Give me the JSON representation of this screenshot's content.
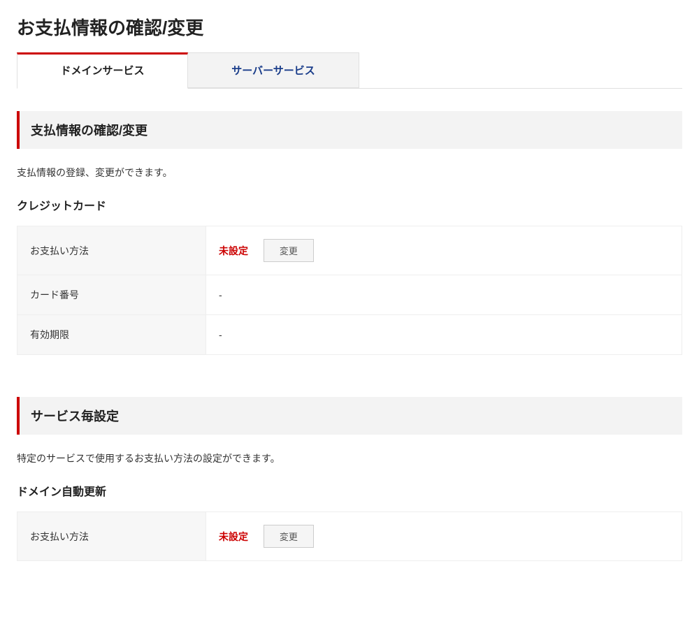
{
  "pageTitle": "お支払情報の確認/変更",
  "tabs": {
    "domain": "ドメインサービス",
    "server": "サーバーサービス"
  },
  "section1": {
    "header": "支払情報の確認/変更",
    "description": "支払情報の登録、変更ができます。",
    "creditCard": {
      "title": "クレジットカード",
      "rows": {
        "paymentMethodLabel": "お支払い方法",
        "paymentMethodStatus": "未設定",
        "paymentMethodButton": "変更",
        "cardNumberLabel": "カード番号",
        "cardNumberValue": "-",
        "expiryLabel": "有効期限",
        "expiryValue": "-"
      }
    }
  },
  "section2": {
    "header": "サービス毎設定",
    "description": "特定のサービスで使用するお支払い方法の設定ができます。",
    "domainAutoRenew": {
      "title": "ドメイン自動更新",
      "rows": {
        "paymentMethodLabel": "お支払い方法",
        "paymentMethodStatus": "未設定",
        "paymentMethodButton": "変更"
      }
    }
  }
}
